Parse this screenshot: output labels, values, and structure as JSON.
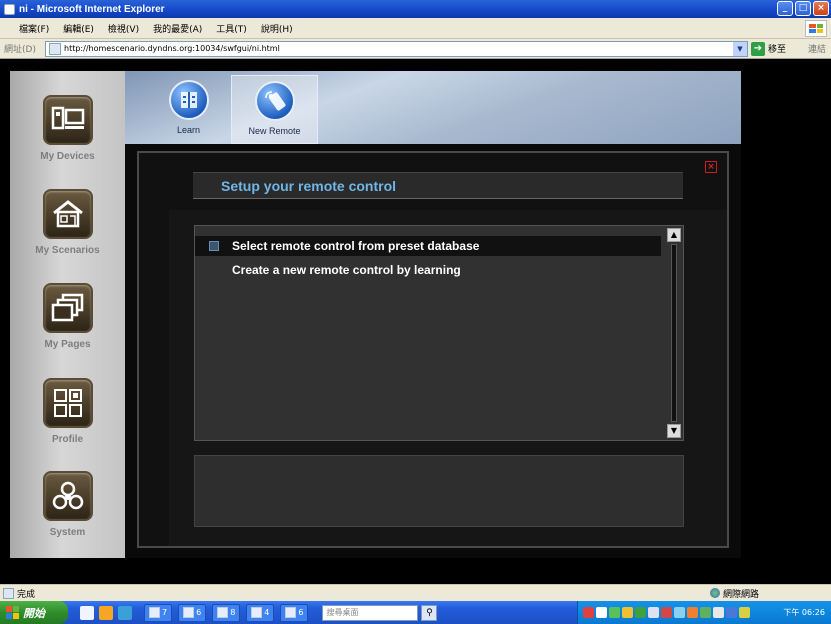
{
  "window": {
    "title": "ni - Microsoft Internet Explorer",
    "buttons": {
      "minimize": "_",
      "maximize": "□",
      "close": "×"
    }
  },
  "menu": [
    "檔案(F)",
    "編輯(E)",
    "檢視(V)",
    "我的最愛(A)",
    "工具(T)",
    "說明(H)"
  ],
  "address": {
    "label": "網址(D)",
    "url": "http://homescenario.dyndns.org:10034/swfgui/ni.html",
    "go_label": "移至",
    "links_label": "連結"
  },
  "sidebar": {
    "items": [
      {
        "label": "My Devices",
        "icon": "devices-icon"
      },
      {
        "label": "My Scenarios",
        "icon": "house-icon"
      },
      {
        "label": "My Pages",
        "icon": "pages-icon"
      },
      {
        "label": "Profile",
        "icon": "profile-grid-icon"
      },
      {
        "label": "System",
        "icon": "system-icon"
      }
    ]
  },
  "toolbar": {
    "learn_label": "Learn",
    "new_remote_label": "New Remote"
  },
  "panel": {
    "title": "Setup your remote control",
    "close_glyph": "×",
    "options": [
      "Select remote control from preset database",
      "Create a new remote control by learning"
    ],
    "scroll_up": "▲",
    "scroll_down": "▼"
  },
  "status": {
    "text": "完成",
    "zone": "網際網路"
  },
  "taskbar": {
    "start_label": "開始",
    "tasks": [
      "7",
      "6",
      "8",
      "4",
      "6"
    ],
    "search_placeholder": "搜尋桌面",
    "clock": "下午 06:26"
  },
  "colors": {
    "title_accent": "#6fb6e6",
    "toolbar_bg": "#c9d6e7",
    "sidebar_bg": "#d7d7d7",
    "panel_bg": "#111111"
  }
}
